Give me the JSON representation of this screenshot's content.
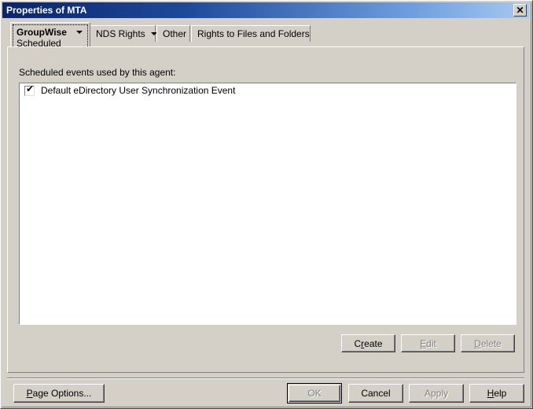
{
  "window": {
    "title": "Properties of MTA",
    "close_icon": "close-x-icon",
    "close_glyph": "✕",
    "titlebar_color_left": "#0A246A",
    "titlebar_color_right": "#A8C9F0",
    "face_color": "#D4D0C8"
  },
  "tabs": {
    "active": {
      "line1": "GroupWise",
      "line2": "Scheduled Events",
      "has_dropdown": true,
      "dropdown_icon": "chevron-down-icon"
    },
    "items": [
      {
        "label": "NDS Rights",
        "has_dropdown": true,
        "dropdown_icon": "chevron-down-icon"
      },
      {
        "label": "Other",
        "has_dropdown": false
      },
      {
        "label": "Rights to Files and Folders",
        "has_dropdown": false
      }
    ]
  },
  "panel": {
    "caption": "Scheduled events used by this agent:",
    "list": {
      "rows": [
        {
          "label": "Default eDirectory User Synchronization Event",
          "checked": true,
          "check_glyph": "✔"
        }
      ]
    },
    "actions": [
      {
        "label_before": "C",
        "accel": "r",
        "label_after": "eate",
        "full": "Create",
        "enabled": true
      },
      {
        "label_before": "",
        "accel": "E",
        "label_after": "dit",
        "full": "Edit",
        "enabled": false
      },
      {
        "label_before": "",
        "accel": "D",
        "label_after": "elete",
        "full": "Delete",
        "enabled": false
      }
    ]
  },
  "bottom": {
    "page_options": {
      "label_before": "",
      "accel": "P",
      "label_after": "age Options...",
      "full": "Page Options...",
      "enabled": true
    },
    "ok": {
      "full": "OK",
      "enabled": false,
      "is_default": true
    },
    "cancel": {
      "full": "Cancel",
      "enabled": true
    },
    "apply": {
      "full": "Apply",
      "enabled": false
    },
    "help": {
      "label_before": "",
      "accel": "H",
      "label_after": "elp",
      "full": "Help",
      "enabled": true
    }
  }
}
